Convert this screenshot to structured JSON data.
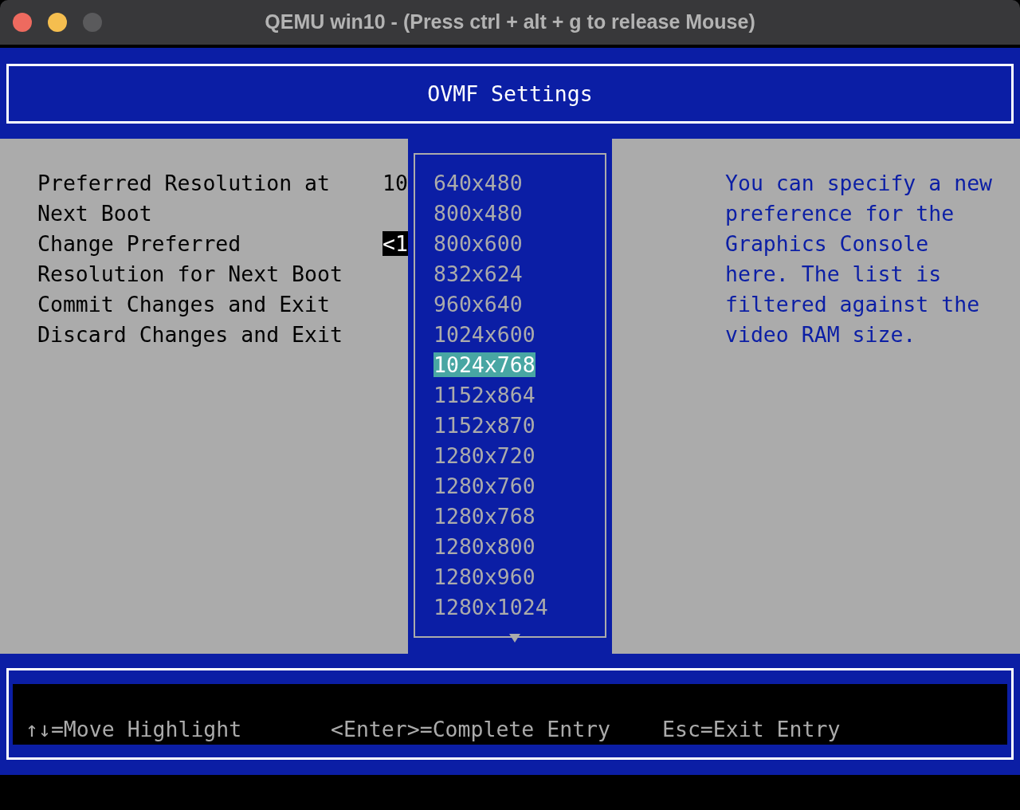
{
  "window": {
    "title": "QEMU win10 - (Press ctrl + alt + g to release Mouse)"
  },
  "header": {
    "title": "OVMF Settings"
  },
  "menu": [
    {
      "label": "Preferred Resolution at Next Boot",
      "value": "10",
      "selected": false
    },
    {
      "label": "Change Preferred Resolution for Next Boot",
      "value": "<1",
      "selected": true
    },
    {
      "label": "Commit Changes and Exit",
      "selected": false
    },
    {
      "label": "Discard Changes and Exit",
      "selected": false
    }
  ],
  "popup": {
    "options": [
      {
        "label": "640x480",
        "selected": false
      },
      {
        "label": "800x480",
        "selected": false
      },
      {
        "label": "800x600",
        "selected": false
      },
      {
        "label": "832x624",
        "selected": false
      },
      {
        "label": "960x640",
        "selected": false
      },
      {
        "label": "1024x600",
        "selected": false
      },
      {
        "label": "1024x768",
        "selected": true
      },
      {
        "label": "1152x864",
        "selected": false
      },
      {
        "label": "1152x870",
        "selected": false
      },
      {
        "label": "1280x720",
        "selected": false
      },
      {
        "label": "1280x760",
        "selected": false
      },
      {
        "label": "1280x768",
        "selected": false
      },
      {
        "label": "1280x800",
        "selected": false
      },
      {
        "label": "1280x960",
        "selected": false
      },
      {
        "label": "1280x1024",
        "selected": false
      }
    ]
  },
  "help_text": "You can specify a new preference for the Graphics Console here. The list is filtered against the video RAM size.",
  "footer": {
    "hints": [
      "↑↓=Move Highlight",
      "<Enter>=Complete Entry",
      "Esc=Exit Entry"
    ]
  }
}
